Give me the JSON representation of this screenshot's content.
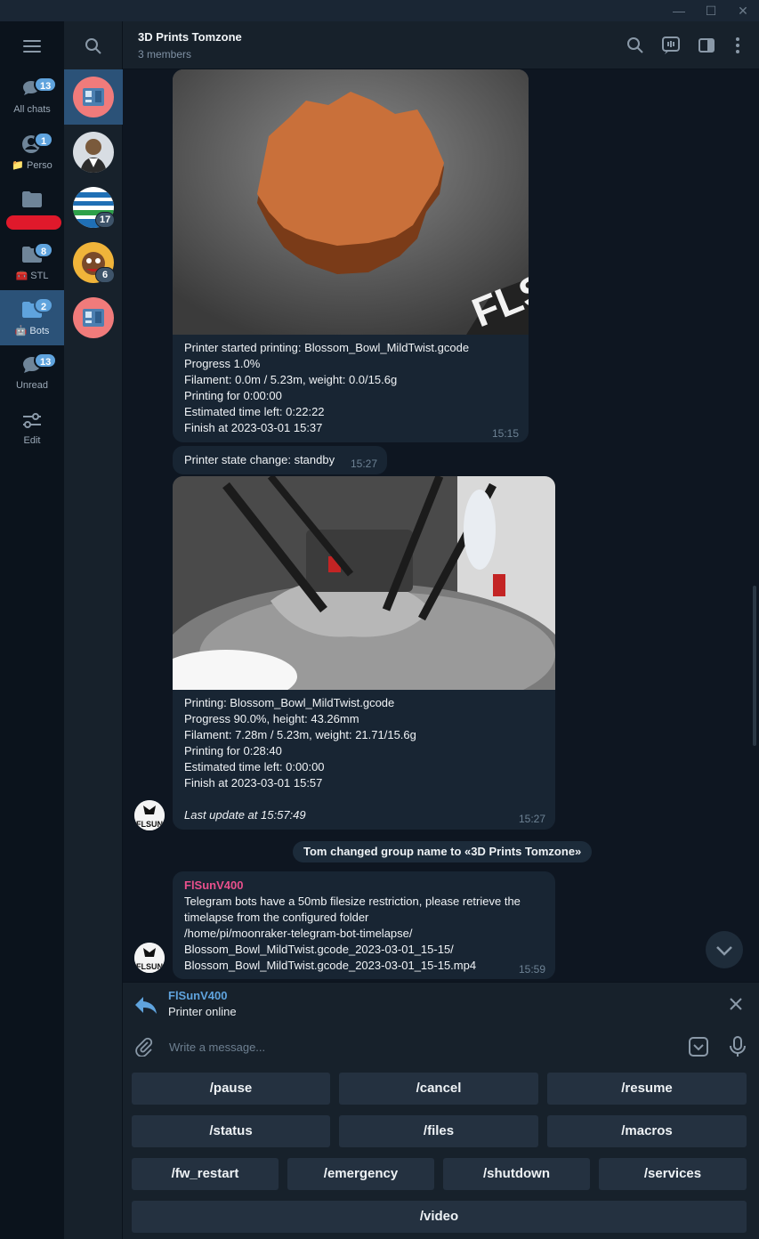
{
  "window": {
    "minimize_glyph": "—",
    "maximize_glyph": "☐",
    "close_glyph": "✕"
  },
  "folders": [
    {
      "label": "All chats",
      "badge": "13",
      "icon": "chat-bubbles-icon"
    },
    {
      "label": "Perso",
      "badge": "1",
      "icon": "person-icon",
      "emoji": "📁"
    },
    {
      "label": "",
      "badge": "",
      "icon": "folder-icon",
      "redacted": true
    },
    {
      "label": "STL",
      "badge": "8",
      "icon": "folder-icon",
      "emoji": "🧰"
    },
    {
      "label": "Bots",
      "badge": "2",
      "icon": "folder-icon",
      "emoji": "🤖",
      "active": true
    },
    {
      "label": "Unread",
      "badge": "13",
      "icon": "chat-bubble-icon"
    },
    {
      "label": "Edit",
      "badge": "",
      "icon": "sliders-icon"
    }
  ],
  "chat_badges": [
    "17",
    "6"
  ],
  "header": {
    "title": "3D Prints Tomzone",
    "subtitle": "3 members"
  },
  "messages": {
    "msg1": {
      "text": "Printer started printing: Blossom_Bowl_MildTwist.gcode\nProgress 1.0%\nFilament: 0.0m / 5.23m, weight: 0.0/15.6g\nPrinting for 0:00:00\nEstimated time left: 0:22:22\nFinish at 2023-03-01 15:37",
      "time": "15:15"
    },
    "msg2": {
      "text": "Printer state change: standby",
      "time": "15:27"
    },
    "msg3": {
      "text": "Printing: Blossom_Bowl_MildTwist.gcode\nProgress 90.0%, height: 43.26mm\nFilament: 7.28m / 5.23m, weight: 21.71/15.6g\nPrinting for 0:28:40\nEstimated time left: 0:00:00\nFinish at 2023-03-01 15:57",
      "last_update": "Last update at 15:57:49",
      "time": "15:27"
    },
    "service": "Tom changed group name to «3D Prints Tomzone»",
    "msg4": {
      "sender": "FlSunV400",
      "text": "Telegram bots have a 50mb filesize restriction, please retrieve the\ntimelapse from the configured folder\n/home/pi/moonraker-telegram-bot-timelapse/\nBlossom_Bowl_MildTwist.gcode_2023-03-01_15-15/\nBlossom_Bowl_MildTwist.gcode_2023-03-01_15-15.mp4",
      "time": "15:59"
    },
    "image_watermark": "FLSU"
  },
  "reply": {
    "name": "FlSunV400",
    "text": "Printer online"
  },
  "composer": {
    "placeholder": "Write a message..."
  },
  "keyboard": {
    "row1": [
      "/pause",
      "/cancel",
      "/resume"
    ],
    "row2": [
      "/status",
      "/files",
      "/macros"
    ],
    "row3": [
      "/fw_restart",
      "/emergency",
      "/shutdown",
      "/services"
    ],
    "row4": [
      "/video"
    ]
  },
  "colors": {
    "accent": "#5fa3dd",
    "sender": "#e9508c",
    "active_folder": "#2b5278",
    "bubble": "#182533",
    "redaction": "#e0192b"
  }
}
